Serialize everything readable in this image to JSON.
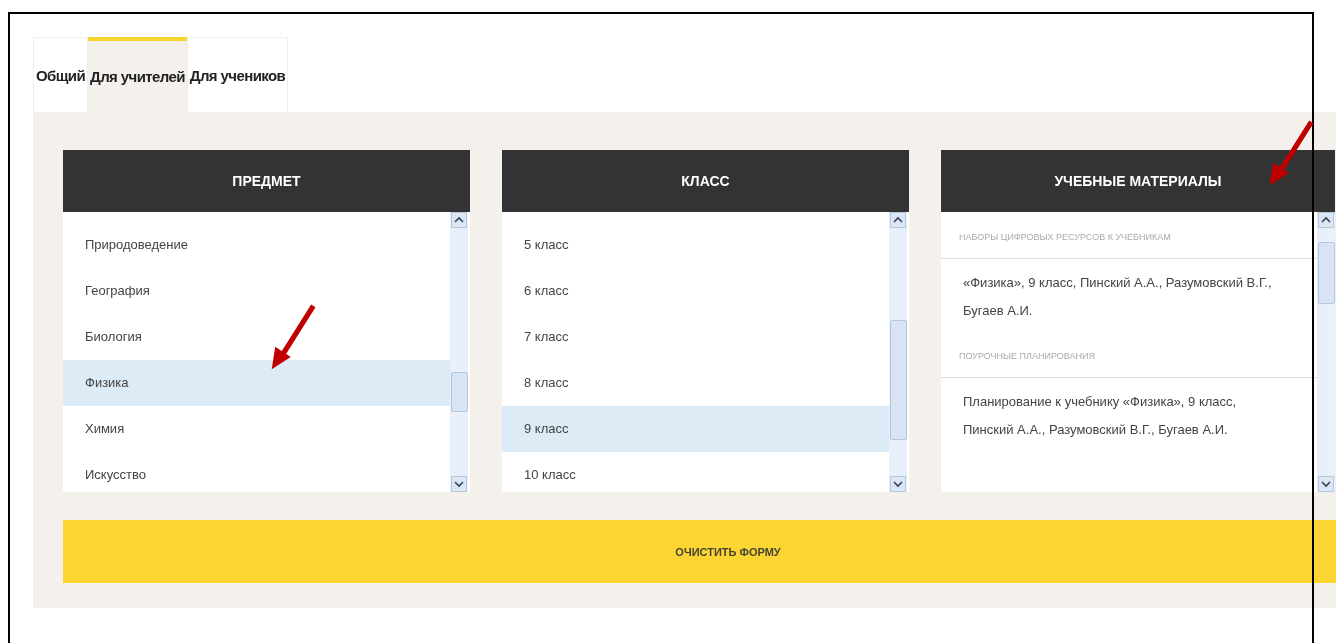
{
  "tabs": [
    {
      "label": "Общий",
      "selected": false
    },
    {
      "label": "Для учителей",
      "selected": true
    },
    {
      "label": "Для учеников",
      "selected": false
    }
  ],
  "subject": {
    "heading": "ПРЕДМЕТ",
    "items": [
      {
        "label": "Природоведение",
        "selected": false
      },
      {
        "label": "География",
        "selected": false
      },
      {
        "label": "Биология",
        "selected": false
      },
      {
        "label": "Физика",
        "selected": true
      },
      {
        "label": "Химия",
        "selected": false
      },
      {
        "label": "Искусство",
        "selected": false
      }
    ]
  },
  "grade": {
    "heading": "КЛАСС",
    "items": [
      {
        "label": "5 класс",
        "selected": false
      },
      {
        "label": "6 класс",
        "selected": false
      },
      {
        "label": "7 класс",
        "selected": false
      },
      {
        "label": "8 класс",
        "selected": false
      },
      {
        "label": "9 класс",
        "selected": true
      },
      {
        "label": "10 класс",
        "selected": false
      }
    ]
  },
  "materials": {
    "heading": "УЧЕБНЫЕ МАТЕРИАЛЫ",
    "groups": [
      {
        "title": "НАБОРЫ ЦИФРОВЫХ РЕСУРСОВ К УЧЕБНИКАМ",
        "entries": [
          "«Физика», 9 класс, Пинский А.А., Разумовский В.Г., Бугаев А.И."
        ]
      },
      {
        "title": "ПОУРОЧНЫЕ ПЛАНИРОВАНИЯ",
        "entries": [
          "Планирование к учебнику «Физика», 9 класс, Пинский А.А., Разумовский В.Г., Бугаев А.И."
        ]
      }
    ]
  },
  "clear_button": "ОЧИСТИТЬ ФОРМУ"
}
